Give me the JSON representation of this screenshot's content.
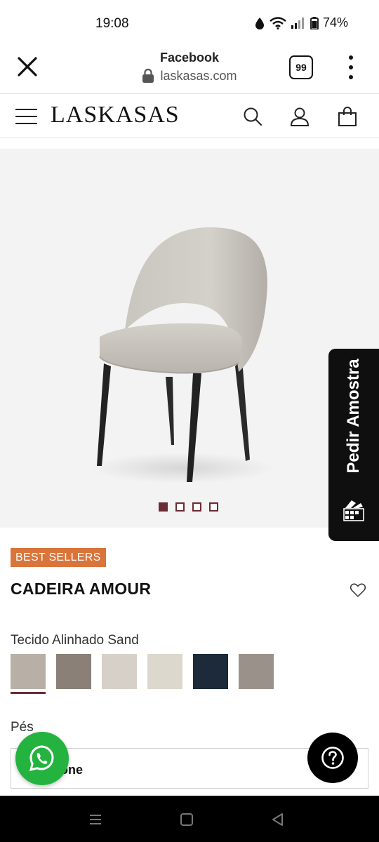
{
  "status_bar": {
    "time": "19:08",
    "battery": "74%",
    "icons": [
      "data-saver-icon",
      "wifi-icon",
      "signal-icon",
      "battery-icon"
    ]
  },
  "browser": {
    "title": "Facebook",
    "domain": "laskasas.com",
    "tab_count": "99",
    "icons": [
      "close-icon",
      "lock-icon",
      "kebab-menu-icon"
    ]
  },
  "site_header": {
    "logo": "LASKASAS",
    "icons": [
      "hamburger-menu-icon",
      "search-icon",
      "user-icon",
      "shopping-bag-icon"
    ]
  },
  "gallery": {
    "image_count": 4,
    "active_index": 0
  },
  "sample_tab": {
    "label": "Pedir Amostra",
    "icon": "color-palette-icon"
  },
  "product": {
    "badge": "BEST SELLERS",
    "title": "CADEIRA AMOUR",
    "fabric_label": "Tecido Alinhado Sand",
    "swatches": [
      {
        "color": "#b8b0a6",
        "selected": true
      },
      {
        "color": "#8a8077",
        "selected": false
      },
      {
        "color": "#d6d0c8",
        "selected": false
      },
      {
        "color": "#dcd8cd",
        "selected": false
      },
      {
        "color": "#1c2a3a",
        "selected": false
      },
      {
        "color": "#9a928a",
        "selected": false
      }
    ],
    "feet_label": "Pés",
    "feet_value": "one"
  },
  "colors": {
    "accent": "#6b2b35",
    "badge": "#d9743a",
    "whatsapp": "#25b33f"
  },
  "floating": {
    "whatsapp_icon": "whatsapp-icon",
    "help_icon": "question-mark-icon"
  },
  "system_nav": {
    "icons": [
      "recent-apps-icon",
      "home-icon",
      "back-icon"
    ]
  }
}
